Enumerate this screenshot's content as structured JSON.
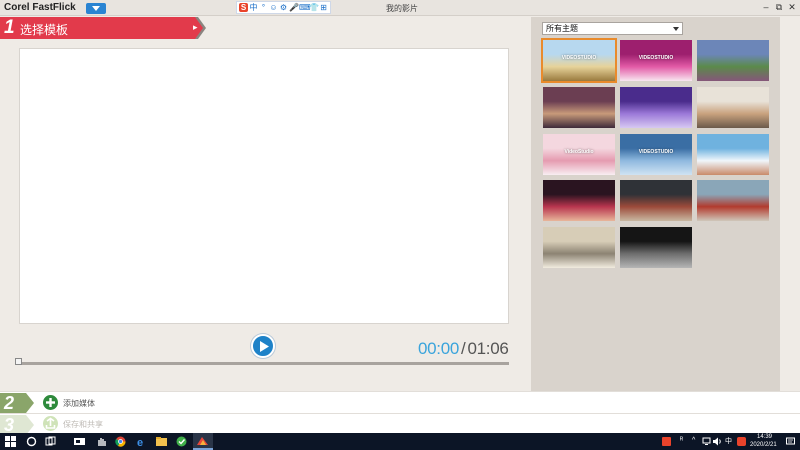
{
  "window": {
    "app_title": "Corel FastFlick",
    "title": "我的影片",
    "controls": [
      "–",
      "⧉",
      "✕"
    ]
  },
  "ime_toolbar": [
    "S",
    "中",
    "°",
    "☺",
    "⚙",
    "🎤",
    "⌨",
    "👕",
    "⊞"
  ],
  "step1": {
    "number": "1",
    "label": "选择模板"
  },
  "player": {
    "current_time": "00:00",
    "separator": "/",
    "total_time": "01:06"
  },
  "theme_filter": {
    "selected": "所有主题"
  },
  "templates": [
    {
      "name": "template-videostudio-wheat",
      "caption": "VIDEOSTUDIO",
      "selected": true,
      "colors": [
        "#b7d8ef",
        "#e7d39a",
        "#9a7a3e"
      ]
    },
    {
      "name": "template-pink-frame",
      "caption": "VIDEOSTUDIO",
      "selected": false,
      "colors": [
        "#9d1f6e",
        "#e25aa6",
        "#f8e6f0"
      ]
    },
    {
      "name": "template-landscape-purple",
      "caption": "",
      "selected": false,
      "colors": [
        "#6c86b8",
        "#5b8a4a",
        "#86567a"
      ]
    },
    {
      "name": "template-couple-vintage",
      "caption": "",
      "selected": false,
      "colors": [
        "#6b3e52",
        "#c89a7a",
        "#3e2a3a"
      ]
    },
    {
      "name": "template-purple-sparkle",
      "caption": "",
      "selected": false,
      "colors": [
        "#4a2c8c",
        "#9b78d8",
        "#d6c8f2"
      ]
    },
    {
      "name": "template-family-portrait",
      "caption": "",
      "selected": false,
      "colors": [
        "#e8e2d8",
        "#c9a27e",
        "#6b5a4a"
      ]
    },
    {
      "name": "template-floral-pink",
      "caption": "VideoStudio",
      "selected": false,
      "colors": [
        "#f4d7df",
        "#e59bb0",
        "#f8eef2"
      ]
    },
    {
      "name": "template-blue-ice",
      "caption": "VIDEOSTUDIO",
      "selected": false,
      "colors": [
        "#3a6ea4",
        "#8fb9df",
        "#cfe3f3"
      ]
    },
    {
      "name": "template-kids-blue",
      "caption": "",
      "selected": false,
      "colors": [
        "#6fb2df",
        "#f0f6fb",
        "#c98a6a"
      ]
    },
    {
      "name": "template-couple-red",
      "caption": "",
      "selected": false,
      "colors": [
        "#2a1420",
        "#b8354e",
        "#e8b59a"
      ]
    },
    {
      "name": "template-red-van-sunset",
      "caption": "",
      "selected": false,
      "colors": [
        "#2f3237",
        "#9c4a3a",
        "#c9b8a2"
      ]
    },
    {
      "name": "template-red-van-sky",
      "caption": "",
      "selected": false,
      "colors": [
        "#8aa6b8",
        "#b23b2e",
        "#cfc7ba"
      ]
    },
    {
      "name": "template-vintage-car-sepia",
      "caption": "",
      "selected": false,
      "colors": [
        "#d7cdb7",
        "#8c8373",
        "#f2ecdf"
      ]
    },
    {
      "name": "template-vintage-car-dark",
      "caption": "",
      "selected": false,
      "colors": [
        "#151515",
        "#6d6d6d",
        "#b5b5b5"
      ]
    }
  ],
  "steps": [
    {
      "number": "2",
      "label": "添加媒体",
      "icon": "plus-circle-icon",
      "enabled": true
    },
    {
      "number": "3",
      "label": "保存和共享",
      "icon": "save-share-icon",
      "enabled": false
    }
  ],
  "taskbar": {
    "time": "14:39",
    "date": "2020/2/21",
    "ime": "中",
    "apps": [
      "windows-start-icon",
      "cortana-icon",
      "task-view-icon",
      "media-icon",
      "hand-icon",
      "chrome-icon",
      "edge-icon",
      "explorer-icon",
      "app-green-icon",
      "fastflick-icon"
    ]
  }
}
